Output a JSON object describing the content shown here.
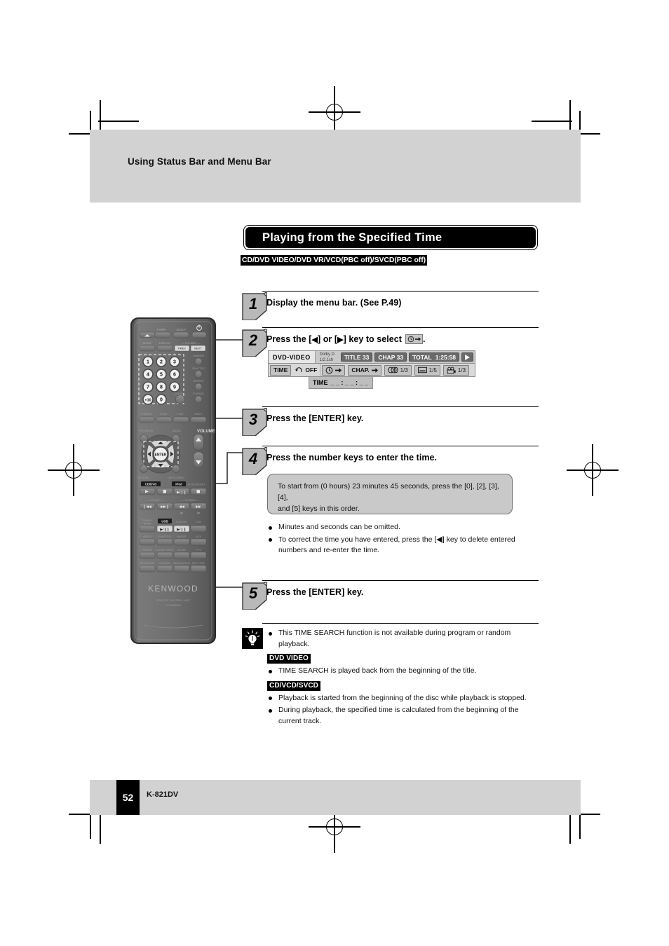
{
  "header": {
    "running_head": "Using Status Bar and Menu Bar"
  },
  "section": {
    "heading": "Playing from the Specified Time",
    "disc_types": "CD/DVD VIDEO/DVD VR/VCD(PBC off)/SVCD(PBC off)"
  },
  "steps": [
    {
      "number": "1",
      "text": "Display the menu bar. (See P.49)"
    },
    {
      "number": "2",
      "text_before": "Press the [",
      "left_key": "◀",
      "text_mid": "] or [",
      "right_key": "▶",
      "text_after": "] key to select",
      "icon": "clock-arrow-icon",
      "text_end": "."
    },
    {
      "number": "3",
      "text": "Press the [ENTER] key."
    },
    {
      "number": "4",
      "text": "Press the number keys to enter the time."
    },
    {
      "number": "5",
      "text": "Press the [ENTER] key."
    }
  ],
  "status_bar": {
    "disc_label": "DVD-VIDEO",
    "audio_format_line1": "Dolby D",
    "audio_format_line2": "1/2.1ch",
    "title_chip": "TITLE 33",
    "chapter_chip": "CHAP 33",
    "total_chip_label": "TOTAL",
    "total_chip_value": "1:25:58",
    "play_icon": "play-triangle-icon",
    "menu_items": [
      {
        "icon": "",
        "label": "TIME",
        "value": "",
        "boxed": true
      },
      {
        "icon": "repeat-off-icon",
        "label": "OFF",
        "value": "",
        "boxed": false
      },
      {
        "icon": "clock-arrow-icon",
        "label": "",
        "value": "",
        "boxed": true
      },
      {
        "icon": "",
        "label": "CHAP.",
        "value": "",
        "boxed": true,
        "arrow": "➜"
      },
      {
        "icon": "audio-track-icon",
        "label": "",
        "value": "1/3",
        "boxed": true
      },
      {
        "icon": "subtitle-icon",
        "label": "",
        "value": "1/5",
        "boxed": true
      },
      {
        "icon": "camera-angle-icon",
        "label": "",
        "value": "1/3",
        "boxed": true
      }
    ],
    "time_entry_label": "TIME",
    "time_entry_blanks": "_ _ : _ _ : _ _"
  },
  "note_box": {
    "line1": "To start from (0 hours) 23 minutes 45 seconds, press the [0], [2], [3], [4],",
    "line2": "and [5] keys in this order."
  },
  "step4_bullets": [
    {
      "text": "Minutes and seconds can be omitted."
    },
    {
      "text_before": "To correct the time you have entered, press the [",
      "key": "◀",
      "text_after": "] key to delete entered numbers and re-enter the time."
    }
  ],
  "tips": {
    "icon": "lightbulb-icon",
    "intro": "This TIME SEARCH function is not available during program or random playback.",
    "groups": [
      {
        "tag": "DVD VIDEO",
        "bullets": [
          "TIME SEARCH is played back from the beginning of the title."
        ]
      },
      {
        "tag": "CD/VCD/SVCD",
        "bullets": [
          "Playback is started from the beginning of the disc while playback is stopped.",
          "During playback, the specified time is calculated from the beginning of the current track."
        ]
      }
    ]
  },
  "footer": {
    "page_number": "52",
    "model": "K-821DV"
  },
  "remote": {
    "brand": "KENWOOD",
    "unit_line1": "REMOTE CONTROL UNIT",
    "unit_line2": "RC-R0860/E",
    "top_labels": [
      "TIMER",
      "SLEEP"
    ],
    "power_icon": "power-icon",
    "eject_icon": "eject-icon",
    "row2_labels": [
      "MODE",
      "DISPLAY",
      "— FOLDER —"
    ],
    "folder_buttons": [
      "PREV",
      "NEXT"
    ],
    "numeric_keys": [
      "1",
      "2",
      "3",
      "4",
      "5",
      "6",
      "7",
      "8",
      "9",
      "+10",
      "0"
    ],
    "side_labels": [
      "DIMMER",
      "SHUTTLE",
      "REPEAT",
      "P.MODE"
    ],
    "clear_label": "CLEAR",
    "tone_labels": [
      "D-BASS",
      "TONE",
      "FLAT",
      "MUTE"
    ],
    "nav_labels": [
      "TOP MENU",
      "MENU",
      "VOLUME"
    ],
    "enter_label": "ENTER",
    "nav_bottom_labels": [
      "RETURN",
      "ON SCREEN"
    ],
    "transport_labels": [
      "CD/DVD",
      "iPod",
      "AUTO/MONO"
    ],
    "pcall_label": "— P.CALL —",
    "tuning_label": "— TUNING —",
    "source_labels": [
      "TUNER/BAND",
      "USB",
      "D.AUDIO",
      "D-IN"
    ],
    "func_row1": [
      "AUDIO",
      "SUBTITLE",
      "ANGLE",
      "AUX"
    ],
    "func_row2": [
      "SOUND",
      "CLEAR VOICE",
      "ZOOM",
      "PTY"
    ],
    "func_row3": [
      "DVD SETUP",
      "PICTURE",
      "RESOLUTION",
      "FILE TYPE"
    ]
  }
}
